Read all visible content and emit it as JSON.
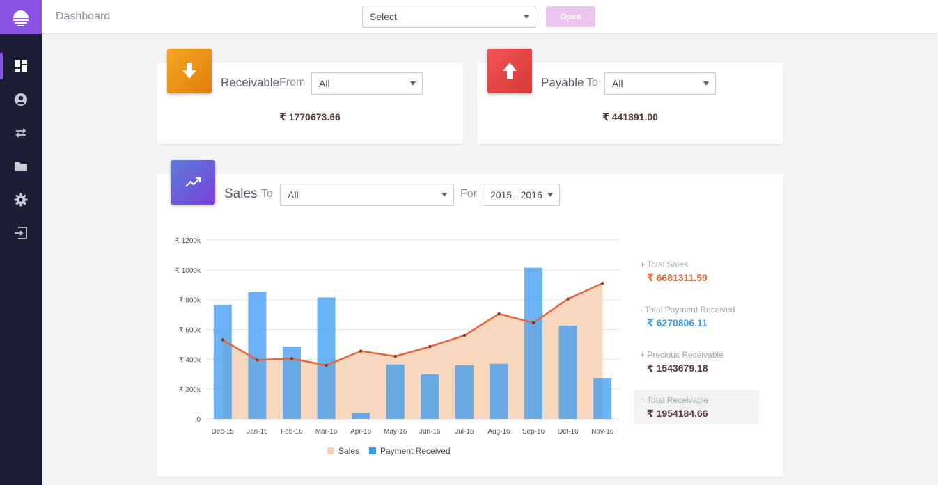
{
  "header": {
    "title": "Dashboard",
    "select_value": "Select",
    "open_label": "Open"
  },
  "sidebar": {
    "items": [
      {
        "icon": "dashboard-icon",
        "active": true
      },
      {
        "icon": "user-icon",
        "active": false
      },
      {
        "icon": "transfer-icon",
        "active": false
      },
      {
        "icon": "folder-icon",
        "active": false
      },
      {
        "icon": "gear-icon",
        "active": false
      },
      {
        "icon": "logout-icon",
        "active": false
      }
    ]
  },
  "receivable": {
    "label": "Receivable",
    "sub": "From",
    "select_value": "All",
    "amount": "₹ 1770673.66"
  },
  "payable": {
    "label": "Payable",
    "sub": "To",
    "select_value": "All",
    "amount": "₹ 441891.00"
  },
  "sales": {
    "label": "Sales",
    "to_label": "To",
    "to_value": "All",
    "for_label": "For",
    "for_value": "2015 - 2016",
    "summary": {
      "total_sales_label": "+ Total Sales",
      "total_sales_value": "₹ 6681311.59",
      "payment_label": "- Total Payment Received",
      "payment_value": "₹ 6270806.11",
      "previous_label": "+ Precious Receivable",
      "previous_value": "₹ 1543679.18",
      "total_receivable_label": "= Total Receivable",
      "total_receivable_value": "₹ 1954184.66"
    }
  },
  "colors": {
    "brand": "#8c52e6",
    "sidebar": "#1c1d35",
    "sales_area": "#f7d3b8",
    "sales_line": "#e8643a",
    "payment_bar": "#3a99f0",
    "sales_text": "#e8643a",
    "payment_text": "#3a99f0"
  },
  "chart_data": {
    "type": "bar",
    "categories": [
      "Dec-15",
      "Jan-16",
      "Feb-16",
      "Mar-16",
      "Apr-16",
      "May-16",
      "Jun-16",
      "Jul-16",
      "Aug-16",
      "Sep-16",
      "Oct-16",
      "Nov-16"
    ],
    "series": [
      {
        "name": "Sales",
        "type": "area",
        "values": [
          530,
          395,
          405,
          360,
          455,
          420,
          485,
          560,
          705,
          645,
          805,
          910
        ]
      },
      {
        "name": "Payment Received",
        "type": "bar",
        "values": [
          765,
          850,
          485,
          815,
          40,
          365,
          300,
          360,
          370,
          1015,
          625,
          275
        ]
      }
    ],
    "yticks": [
      "₹ 1200k",
      "₹ 1000k",
      "₹ 800k",
      "₹ 600k",
      "₹ 400k",
      "₹ 200k",
      "0"
    ],
    "ylim": [
      0,
      1200
    ],
    "grid": true,
    "legend_position": "bottom"
  }
}
